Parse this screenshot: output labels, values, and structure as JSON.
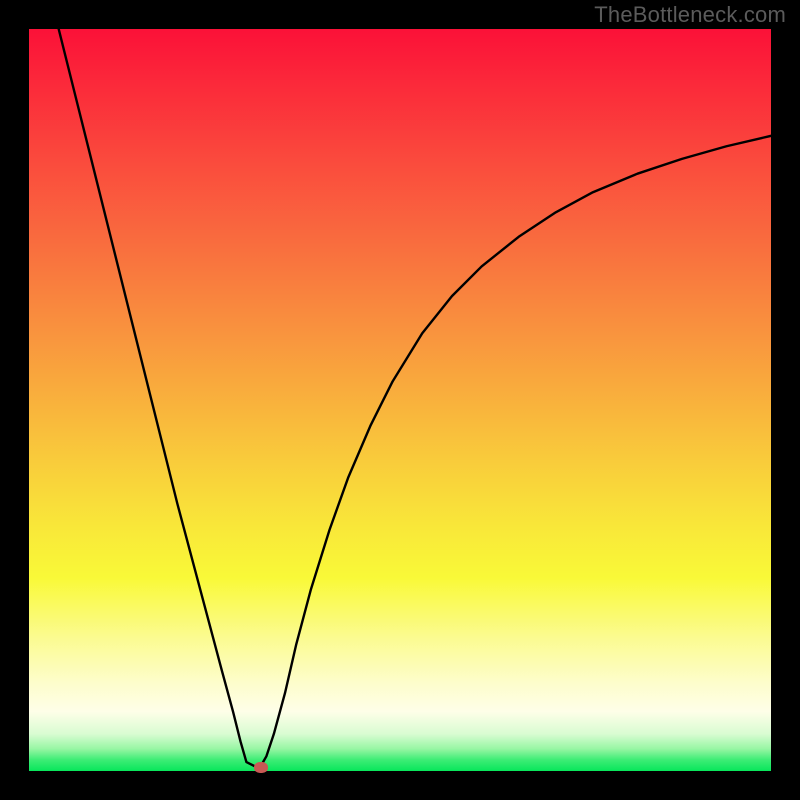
{
  "watermark": "TheBottleneck.com",
  "marker": {
    "x_frac": 0.312,
    "y_frac": 0.994
  },
  "chart_data": {
    "type": "line",
    "title": "",
    "xlabel": "",
    "ylabel": "",
    "xlim": [
      0,
      100
    ],
    "ylim": [
      0,
      100
    ],
    "series": [
      {
        "name": "bottleneck-curve",
        "x": [
          4.0,
          6.0,
          8.0,
          10.0,
          12.0,
          14.0,
          16.0,
          18.0,
          20.0,
          22.0,
          24.0,
          26.0,
          27.5,
          28.5,
          29.3,
          30.5,
          31.2,
          32.0,
          33.0,
          34.5,
          36.0,
          38.0,
          40.5,
          43.0,
          46.0,
          49.0,
          53.0,
          57.0,
          61.0,
          66.0,
          71.0,
          76.0,
          82.0,
          88.0,
          94.0,
          100.0
        ],
        "y": [
          100.0,
          92.0,
          84.0,
          76.0,
          68.0,
          60.0,
          52.0,
          44.0,
          36.0,
          28.5,
          21.0,
          13.5,
          8.0,
          4.0,
          1.2,
          0.6,
          0.6,
          2.0,
          5.0,
          10.5,
          17.0,
          24.5,
          32.5,
          39.5,
          46.5,
          52.5,
          59.0,
          64.0,
          68.0,
          72.0,
          75.3,
          78.0,
          80.5,
          82.5,
          84.2,
          85.6
        ]
      }
    ],
    "marker_point": {
      "x": 31.2,
      "y": 0.6
    },
    "gradient_stops": [
      {
        "pos": 0.0,
        "color": "#fb1138"
      },
      {
        "pos": 0.5,
        "color": "#f9c03c"
      },
      {
        "pos": 0.75,
        "color": "#f9f938"
      },
      {
        "pos": 0.92,
        "color": "#fefee8"
      },
      {
        "pos": 1.0,
        "color": "#08e65b"
      }
    ]
  }
}
